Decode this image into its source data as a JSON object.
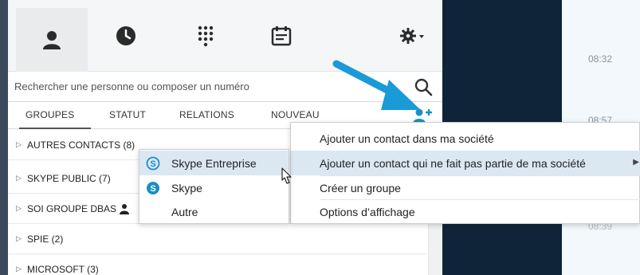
{
  "tabs": {
    "contacts": "contacts-icon",
    "history": "clock-icon",
    "dialpad": "dialpad-icon",
    "meetings": "calendar-icon",
    "settings": "gear-icon"
  },
  "search": {
    "placeholder": "Rechercher une personne ou composer un numéro"
  },
  "filters": [
    "GROUPES",
    "STATUT",
    "RELATIONS",
    "NOUVEAU"
  ],
  "groups": [
    {
      "label": "AUTRES CONTACTS (8)"
    },
    {
      "label": "SKYPE PUBLIC (7)"
    },
    {
      "label": "SOI GROUPE DBAS"
    },
    {
      "label": "SPIE (2)"
    },
    {
      "label": "MICROSOFT (3)"
    }
  ],
  "add_menu": {
    "items": [
      "Ajouter un contact dans ma société",
      "Ajouter un contact qui ne fait pas partie de ma société",
      "Créer un groupe",
      "Options d’affichage"
    ]
  },
  "submenu": {
    "items": [
      "Skype Entreprise",
      "Skype",
      "Autre"
    ]
  },
  "chat": {
    "times": [
      "08:32",
      "08:57"
    ],
    "faint_time": "08:39"
  },
  "colors": {
    "accent": "#1b8ec7",
    "annotation_arrow": "#1a9ad6",
    "dark_pane": "#0f2439",
    "hover": "#dbe8f2"
  }
}
